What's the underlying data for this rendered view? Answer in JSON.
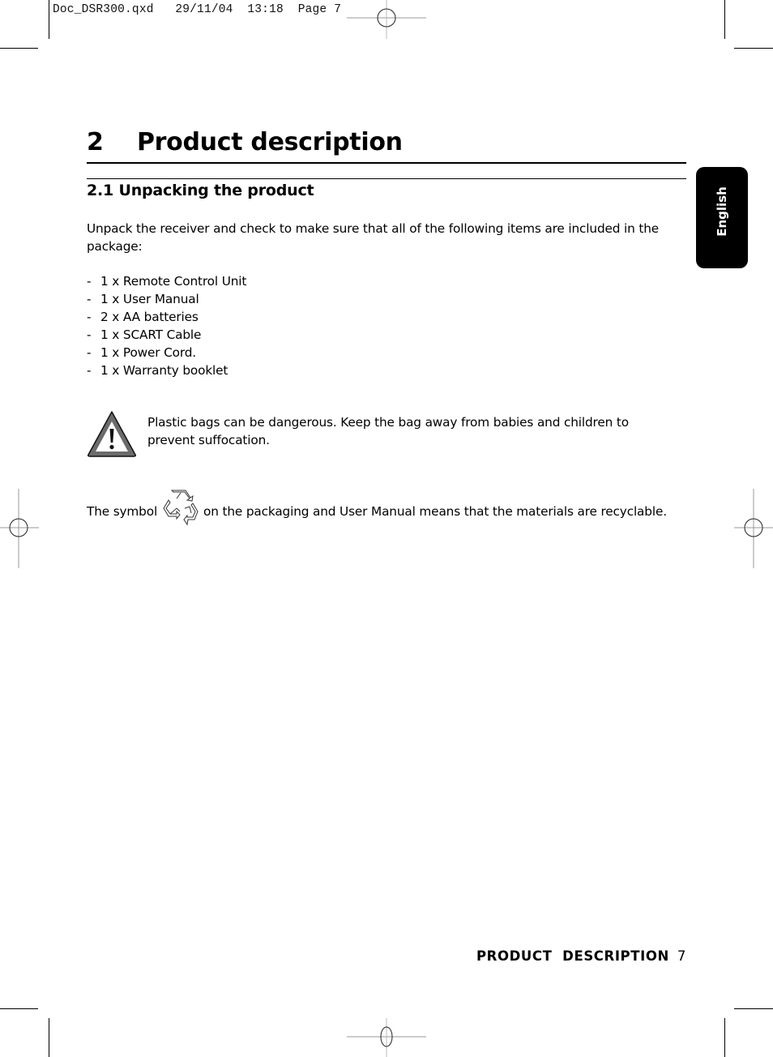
{
  "slug": {
    "file": "Doc_DSR300.qxd",
    "date": "29/11/04",
    "time": "13:18",
    "page": "Page 7"
  },
  "side_tab": {
    "label": "English"
  },
  "chapter": {
    "number": "2",
    "title": "Product description"
  },
  "section": {
    "title": "2.1 Unpacking the product"
  },
  "intro": "Unpack the receiver and check to make sure that all of the following items are included in the package:",
  "items": [
    {
      "dash": "-",
      "text": "1 x Remote Control Unit"
    },
    {
      "dash": "-",
      "text": "1 x User Manual"
    },
    {
      "dash": "-",
      "text": "2 x AA batteries"
    },
    {
      "dash": "-",
      "text": "1 x SCART Cable"
    },
    {
      "dash": "-",
      "text": "1 x Power Cord."
    },
    {
      "dash": "-",
      "text": "1 x Warranty booklet"
    }
  ],
  "warning": {
    "icon": "warning-triangle-icon",
    "text": "Plastic bags can be dangerous. Keep the bag away from babies and children to prevent suffocation."
  },
  "recycle": {
    "before": "The symbol",
    "icon": "recycle-icon",
    "after": "on the packaging and User Manual means that the materials are recyclable."
  },
  "footer": {
    "section": "PRODUCT  DESCRIPTION",
    "page": "7"
  }
}
